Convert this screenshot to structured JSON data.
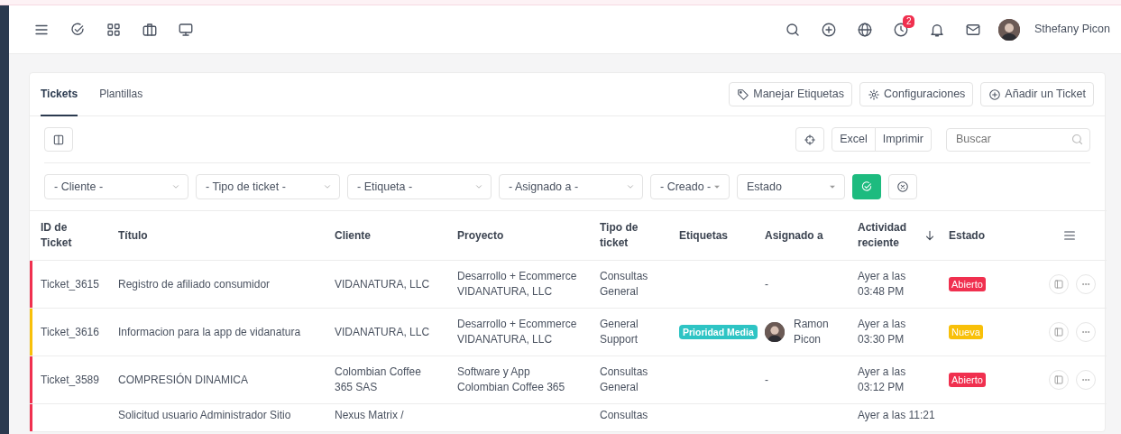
{
  "topbar": {
    "notification_count": "2",
    "user_name": "Sthefany Picon"
  },
  "tabs": [
    {
      "label": "Tickets",
      "selected": true
    },
    {
      "label": "Plantillas",
      "selected": false
    }
  ],
  "actions": [
    {
      "label": "Manejar Etiquetas",
      "kind": "tag"
    },
    {
      "label": "Configuraciones",
      "kind": "settings"
    },
    {
      "label": "Añadir un Ticket",
      "kind": "add"
    }
  ],
  "export_buttons": [
    "Excel",
    "Imprimir"
  ],
  "search": {
    "placeholder": "Buscar"
  },
  "filters": [
    {
      "label": "- Cliente -",
      "kind": "chevron"
    },
    {
      "label": "- Tipo de ticket -",
      "kind": "chevron"
    },
    {
      "label": "- Etiqueta -",
      "kind": "chevron"
    },
    {
      "label": "- Asignado a -",
      "kind": "chevron"
    },
    {
      "label": "- Creado -",
      "kind": "caret"
    },
    {
      "label": "Estado",
      "kind": "caret"
    }
  ],
  "table": {
    "columns": [
      {
        "label": "ID de Ticket"
      },
      {
        "label": "Título"
      },
      {
        "label": "Cliente"
      },
      {
        "label": "Proyecto"
      },
      {
        "label": "Tipo de ticket"
      },
      {
        "label": "Etiquetas"
      },
      {
        "label": "Asignado a"
      },
      {
        "label": "Actividad reciente",
        "sorted_descending": true
      },
      {
        "label": "Estado"
      }
    ],
    "rows": [
      {
        "color": "#f0304f",
        "id": "Ticket_3615",
        "title": "Registro de afiliado consumidor",
        "client": "VIDANATURA, LLC",
        "project": "Desarrollo + Ecommerce VIDANATURA, LLC",
        "type": "Consultas General",
        "labels": [],
        "assignee": {
          "name": "-"
        },
        "activity": "Ayer a las 03:48 PM",
        "status": {
          "text": "Abierto",
          "color": "#f0304f"
        }
      },
      {
        "color": "#f8c009",
        "id": "Ticket_3616",
        "title": "Informacion para la app de vidanatura",
        "client": "VIDANATURA, LLC",
        "project": "Desarrollo + Ecommerce VIDANATURA, LLC",
        "type": "General Support",
        "labels": [
          {
            "text": "Prioridad Media",
            "color": "#2ec4c4"
          }
        ],
        "assignee": {
          "name": "Ramon Picon",
          "avatar": true
        },
        "activity": "Ayer a las 03:30 PM",
        "status": {
          "text": "Nueva",
          "color": "#f8c009"
        }
      },
      {
        "color": "#f0304f",
        "id": "Ticket_3589",
        "title": "COMPRESIÓN DINAMICA",
        "client": "Colombian Coffee 365 SAS",
        "project": "Software y App Colombian Coffee 365",
        "type": "Consultas General",
        "labels": [],
        "assignee": {
          "name": "-"
        },
        "activity": "Ayer a las 03:12 PM",
        "status": {
          "text": "Abierto",
          "color": "#f0304f"
        }
      },
      {
        "color": "#f0304f",
        "title": "Solicitud usuario Administrador Sitio",
        "client": "Nexus Matrix /",
        "type": "Consultas",
        "activity": "Ayer a las 11:21"
      }
    ]
  }
}
